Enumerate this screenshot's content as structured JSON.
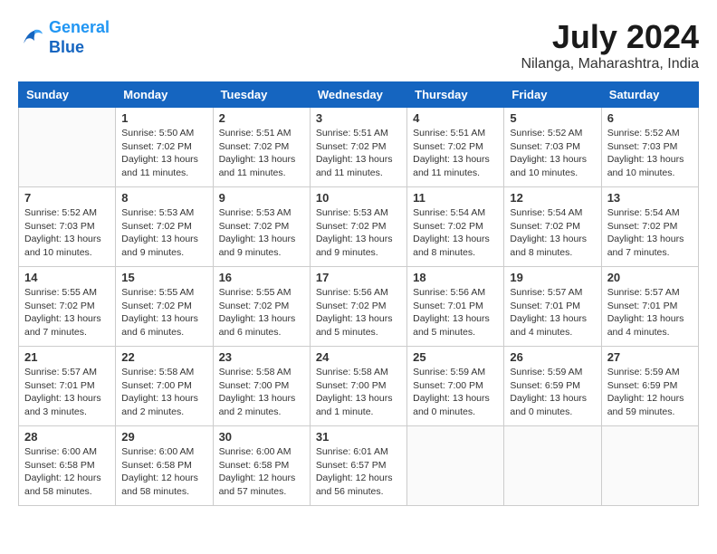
{
  "header": {
    "logo_line1": "General",
    "logo_line2": "Blue",
    "month": "July 2024",
    "location": "Nilanga, Maharashtra, India"
  },
  "days_of_week": [
    "Sunday",
    "Monday",
    "Tuesday",
    "Wednesday",
    "Thursday",
    "Friday",
    "Saturday"
  ],
  "weeks": [
    [
      {
        "num": "",
        "detail": ""
      },
      {
        "num": "1",
        "detail": "Sunrise: 5:50 AM\nSunset: 7:02 PM\nDaylight: 13 hours\nand 11 minutes."
      },
      {
        "num": "2",
        "detail": "Sunrise: 5:51 AM\nSunset: 7:02 PM\nDaylight: 13 hours\nand 11 minutes."
      },
      {
        "num": "3",
        "detail": "Sunrise: 5:51 AM\nSunset: 7:02 PM\nDaylight: 13 hours\nand 11 minutes."
      },
      {
        "num": "4",
        "detail": "Sunrise: 5:51 AM\nSunset: 7:02 PM\nDaylight: 13 hours\nand 11 minutes."
      },
      {
        "num": "5",
        "detail": "Sunrise: 5:52 AM\nSunset: 7:03 PM\nDaylight: 13 hours\nand 10 minutes."
      },
      {
        "num": "6",
        "detail": "Sunrise: 5:52 AM\nSunset: 7:03 PM\nDaylight: 13 hours\nand 10 minutes."
      }
    ],
    [
      {
        "num": "7",
        "detail": "Sunrise: 5:52 AM\nSunset: 7:03 PM\nDaylight: 13 hours\nand 10 minutes."
      },
      {
        "num": "8",
        "detail": "Sunrise: 5:53 AM\nSunset: 7:02 PM\nDaylight: 13 hours\nand 9 minutes."
      },
      {
        "num": "9",
        "detail": "Sunrise: 5:53 AM\nSunset: 7:02 PM\nDaylight: 13 hours\nand 9 minutes."
      },
      {
        "num": "10",
        "detail": "Sunrise: 5:53 AM\nSunset: 7:02 PM\nDaylight: 13 hours\nand 9 minutes."
      },
      {
        "num": "11",
        "detail": "Sunrise: 5:54 AM\nSunset: 7:02 PM\nDaylight: 13 hours\nand 8 minutes."
      },
      {
        "num": "12",
        "detail": "Sunrise: 5:54 AM\nSunset: 7:02 PM\nDaylight: 13 hours\nand 8 minutes."
      },
      {
        "num": "13",
        "detail": "Sunrise: 5:54 AM\nSunset: 7:02 PM\nDaylight: 13 hours\nand 7 minutes."
      }
    ],
    [
      {
        "num": "14",
        "detail": "Sunrise: 5:55 AM\nSunset: 7:02 PM\nDaylight: 13 hours\nand 7 minutes."
      },
      {
        "num": "15",
        "detail": "Sunrise: 5:55 AM\nSunset: 7:02 PM\nDaylight: 13 hours\nand 6 minutes."
      },
      {
        "num": "16",
        "detail": "Sunrise: 5:55 AM\nSunset: 7:02 PM\nDaylight: 13 hours\nand 6 minutes."
      },
      {
        "num": "17",
        "detail": "Sunrise: 5:56 AM\nSunset: 7:02 PM\nDaylight: 13 hours\nand 5 minutes."
      },
      {
        "num": "18",
        "detail": "Sunrise: 5:56 AM\nSunset: 7:01 PM\nDaylight: 13 hours\nand 5 minutes."
      },
      {
        "num": "19",
        "detail": "Sunrise: 5:57 AM\nSunset: 7:01 PM\nDaylight: 13 hours\nand 4 minutes."
      },
      {
        "num": "20",
        "detail": "Sunrise: 5:57 AM\nSunset: 7:01 PM\nDaylight: 13 hours\nand 4 minutes."
      }
    ],
    [
      {
        "num": "21",
        "detail": "Sunrise: 5:57 AM\nSunset: 7:01 PM\nDaylight: 13 hours\nand 3 minutes."
      },
      {
        "num": "22",
        "detail": "Sunrise: 5:58 AM\nSunset: 7:00 PM\nDaylight: 13 hours\nand 2 minutes."
      },
      {
        "num": "23",
        "detail": "Sunrise: 5:58 AM\nSunset: 7:00 PM\nDaylight: 13 hours\nand 2 minutes."
      },
      {
        "num": "24",
        "detail": "Sunrise: 5:58 AM\nSunset: 7:00 PM\nDaylight: 13 hours\nand 1 minute."
      },
      {
        "num": "25",
        "detail": "Sunrise: 5:59 AM\nSunset: 7:00 PM\nDaylight: 13 hours\nand 0 minutes."
      },
      {
        "num": "26",
        "detail": "Sunrise: 5:59 AM\nSunset: 6:59 PM\nDaylight: 13 hours\nand 0 minutes."
      },
      {
        "num": "27",
        "detail": "Sunrise: 5:59 AM\nSunset: 6:59 PM\nDaylight: 12 hours\nand 59 minutes."
      }
    ],
    [
      {
        "num": "28",
        "detail": "Sunrise: 6:00 AM\nSunset: 6:58 PM\nDaylight: 12 hours\nand 58 minutes."
      },
      {
        "num": "29",
        "detail": "Sunrise: 6:00 AM\nSunset: 6:58 PM\nDaylight: 12 hours\nand 58 minutes."
      },
      {
        "num": "30",
        "detail": "Sunrise: 6:00 AM\nSunset: 6:58 PM\nDaylight: 12 hours\nand 57 minutes."
      },
      {
        "num": "31",
        "detail": "Sunrise: 6:01 AM\nSunset: 6:57 PM\nDaylight: 12 hours\nand 56 minutes."
      },
      {
        "num": "",
        "detail": ""
      },
      {
        "num": "",
        "detail": ""
      },
      {
        "num": "",
        "detail": ""
      }
    ]
  ]
}
